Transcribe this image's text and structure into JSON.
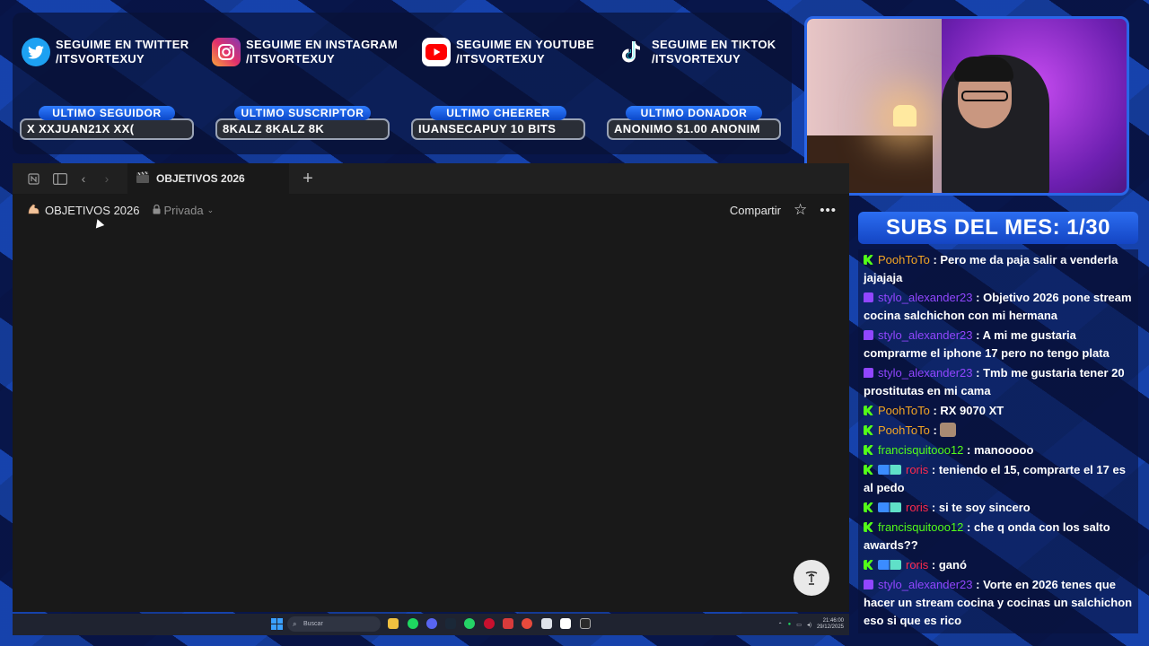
{
  "socials": [
    {
      "icon": "twitter-icon",
      "line1": "SEGUIME EN TWITTER",
      "line2": "/ITSVORTEXUY"
    },
    {
      "icon": "instagram-icon",
      "line1": "SEGUIME EN INSTAGRAM",
      "line2": "/ITSVORTEXUY"
    },
    {
      "icon": "youtube-icon",
      "line1": "SEGUIME EN YOUTUBE",
      "line2": "/ITSVORTEXUY"
    },
    {
      "icon": "tiktok-icon",
      "line1": "SEGUIME EN TIKTOK",
      "line2": "/ITSVORTEXUY"
    }
  ],
  "stats": [
    {
      "label": "ULTIMO SEGUIDOR",
      "value": "X        XXJUAN21X        XX("
    },
    {
      "label": "ULTIMO SUSCRIPTOR",
      "value": "8KALZ        8KALZ        8K"
    },
    {
      "label": "ULTIMO CHEERER",
      "value": "IUANSECAPUY 10 BITS"
    },
    {
      "label": "ULTIMO DONADOR",
      "value": "ANONIMO $1.00        ANONIM"
    }
  ],
  "window": {
    "tab_title": "OBJETIVOS 2026",
    "page_title": "OBJETIVOS 2026",
    "privacy": "Privada",
    "share": "Compartir",
    "help": "?"
  },
  "subs_banner": "SUBS DEL MES: 1/30",
  "chat": [
    {
      "badge": "kick",
      "nick": "PoohToTo",
      "color": "#f5a623",
      "text": "Pero me da paja salir a venderla jajajaja"
    },
    {
      "badge": "twitch",
      "nick": "stylo_alexander23",
      "color": "#9146ff",
      "text": "Objetivo 2026 pone stream cocina salchichon con mi hermana"
    },
    {
      "badge": "twitch",
      "nick": "stylo_alexander23",
      "color": "#9146ff",
      "text": "A mi me gustaria comprarme el iphone 17 pero no tengo plata"
    },
    {
      "badge": "twitch",
      "nick": "stylo_alexander23",
      "color": "#9146ff",
      "text": "Tmb me gustaria tener 20 prostitutas en mi cama"
    },
    {
      "badge": "kick",
      "nick": "PoohToTo",
      "color": "#f5a623",
      "text": "RX 9070 XT"
    },
    {
      "badge": "kick",
      "nick": "PoohToTo",
      "color": "#f5a623",
      "text": ""
    },
    {
      "badge": "kick",
      "nick": "francisquitooo12",
      "color": "#53fc18",
      "text": "manooooo"
    },
    {
      "badge": "kick-extra",
      "nick": "roris",
      "color": "#ff2a4d",
      "text": "teniendo el 15, comprarte el 17 es al pedo"
    },
    {
      "badge": "kick-extra",
      "nick": "roris",
      "color": "#ff2a4d",
      "text": "si te soy sincero"
    },
    {
      "badge": "kick",
      "nick": "francisquitooo12",
      "color": "#53fc18",
      "text": "che q onda con los salto awards??"
    },
    {
      "badge": "kick-extra",
      "nick": "roris",
      "color": "#ff2a4d",
      "text": "ganó"
    },
    {
      "badge": "twitch",
      "nick": "stylo_alexander23",
      "color": "#9146ff",
      "text": "Vorte en 2026 tenes que hacer un stream cocina y cocinas un salchichon eso si que es rico"
    }
  ],
  "taskbar": {
    "search_placeholder": "Buscar",
    "time": "21:46:00",
    "date": "29/12/2025"
  }
}
